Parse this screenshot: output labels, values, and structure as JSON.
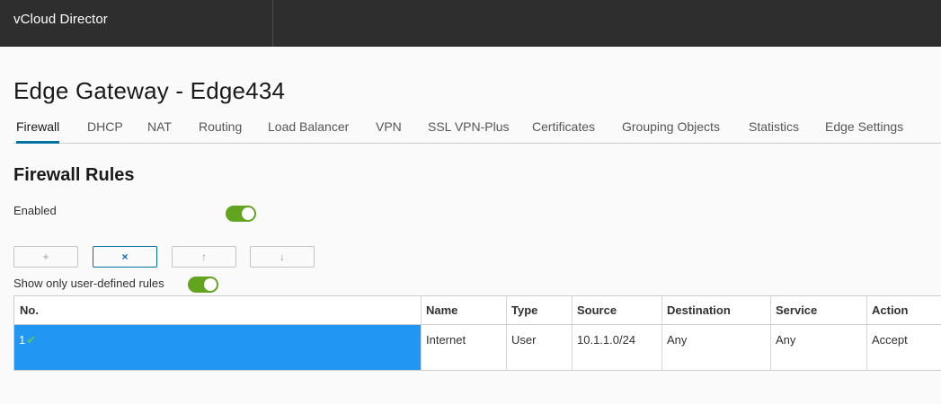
{
  "app": {
    "title": "vCloud Director"
  },
  "page": {
    "title": "Edge Gateway - Edge434"
  },
  "tabs": [
    {
      "label": "Firewall",
      "active": true
    },
    {
      "label": "DHCP"
    },
    {
      "label": "NAT"
    },
    {
      "label": "Routing"
    },
    {
      "label": "Load Balancer"
    },
    {
      "label": "VPN"
    },
    {
      "label": "SSL VPN-Plus"
    },
    {
      "label": "Certificates"
    },
    {
      "label": "Grouping Objects"
    },
    {
      "label": "Statistics"
    },
    {
      "label": "Edge Settings"
    }
  ],
  "firewall": {
    "section_title": "Firewall Rules",
    "enabled_label": "Enabled",
    "enabled": true,
    "toolbar": {
      "add_icon": "+",
      "delete_icon": "×",
      "move_up_icon": "↑",
      "move_down_icon": "↓"
    },
    "show_user_defined_label": "Show only user-defined rules",
    "show_user_defined": true
  },
  "table": {
    "columns": [
      "No.",
      "Name",
      "Type",
      "Source",
      "Destination",
      "Service",
      "Action"
    ],
    "rows": [
      {
        "no": "1",
        "status_icon": "✔",
        "name": "Internet",
        "type": "User",
        "source": "10.1.1.0/24",
        "destination": "Any",
        "service": "Any",
        "action": "Accept"
      }
    ]
  },
  "colors": {
    "header_bg": "#2e2e2e",
    "accent": "#0072a3",
    "toggle_on": "#62a420",
    "row_selected": "#2196f3",
    "check": "#62c84e"
  }
}
